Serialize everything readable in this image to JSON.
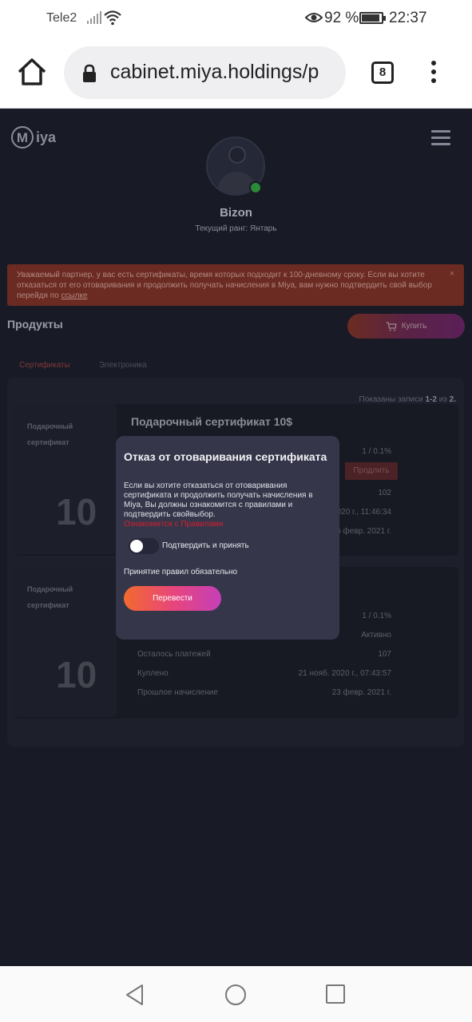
{
  "status_bar": {
    "carrier": "Tele2",
    "battery_percent": "92 %",
    "time": "22:37"
  },
  "browser": {
    "url": "cabinet.miya.holdings/p",
    "tab_count": "8"
  },
  "header": {
    "logo_mark": "M",
    "logo_text": "iya"
  },
  "profile": {
    "username": "Bizon",
    "rank": "Текущий ранг: Янтарь"
  },
  "alert": {
    "text": "Уважаемый партнер, у вас есть сертификаты, время которых подходит к 100-дневному сроку. Если вы хотите отказаться от его отоваривания и продолжить получать начисления в Miya, вам нужно подтвердить свой выбор перейдя по ",
    "link": "ссылке",
    "close": "×"
  },
  "products": {
    "title": "Продукты",
    "buy_label": "Купить",
    "tabs": [
      "Сертификаты",
      "Электроника"
    ],
    "showing_prefix": "Показаны записи ",
    "showing_range": "1-2",
    "showing_mid": " из ",
    "showing_total": "2."
  },
  "cards": [
    {
      "gift_label": "Подарочный сертификат",
      "gift_number": "10",
      "title": "Подарочный сертификат 10$",
      "rows": [
        {
          "label": "",
          "value": "1 / 0.1%"
        },
        {
          "label": "",
          "value": "102"
        },
        {
          "label": "",
          "value": "2020 г., 11:46:34"
        },
        {
          "label": "",
          "value": "5 февр. 2021 г."
        }
      ],
      "extend_label": "Продлить"
    },
    {
      "gift_label": "Подарочный сертификат",
      "gift_number": "10",
      "rows": [
        {
          "label": "",
          "value": "1 / 0.1%"
        },
        {
          "label": "",
          "value": "Активно"
        },
        {
          "label": "Осталось платежей",
          "value": "107"
        },
        {
          "label": "Куплено",
          "value": "21 нояб. 2020 г., 07:43:57"
        },
        {
          "label": "Прошлое начисление",
          "value": "23 февр. 2021 г."
        }
      ]
    }
  ],
  "modal": {
    "title": "Отказ от отоваривания сертификата",
    "text": "Если вы хотите отказаться от отоваривания сертификата и продолжить получать начисления в Miya, Вы должны ознакомится с правилами и подтвердить свойвыбор.",
    "link": "Ознакомится с Правилами",
    "toggle_label": "Подтвердить и принять",
    "toggle_on": false,
    "required_note": "Принятие правил обязательно",
    "submit_label": "Перевести"
  },
  "colors": {
    "accent_orange": "#f26a2e",
    "accent_pink": "#e8467a",
    "accent_purple": "#c53fb8",
    "link_red": "#d22030",
    "online_green": "#2a8a3a"
  },
  "icons": [
    "home-icon",
    "lock-icon",
    "menu-dots-icon",
    "hamburger-icon",
    "cart-icon",
    "back-icon",
    "home-circle-icon",
    "recents-icon"
  ]
}
